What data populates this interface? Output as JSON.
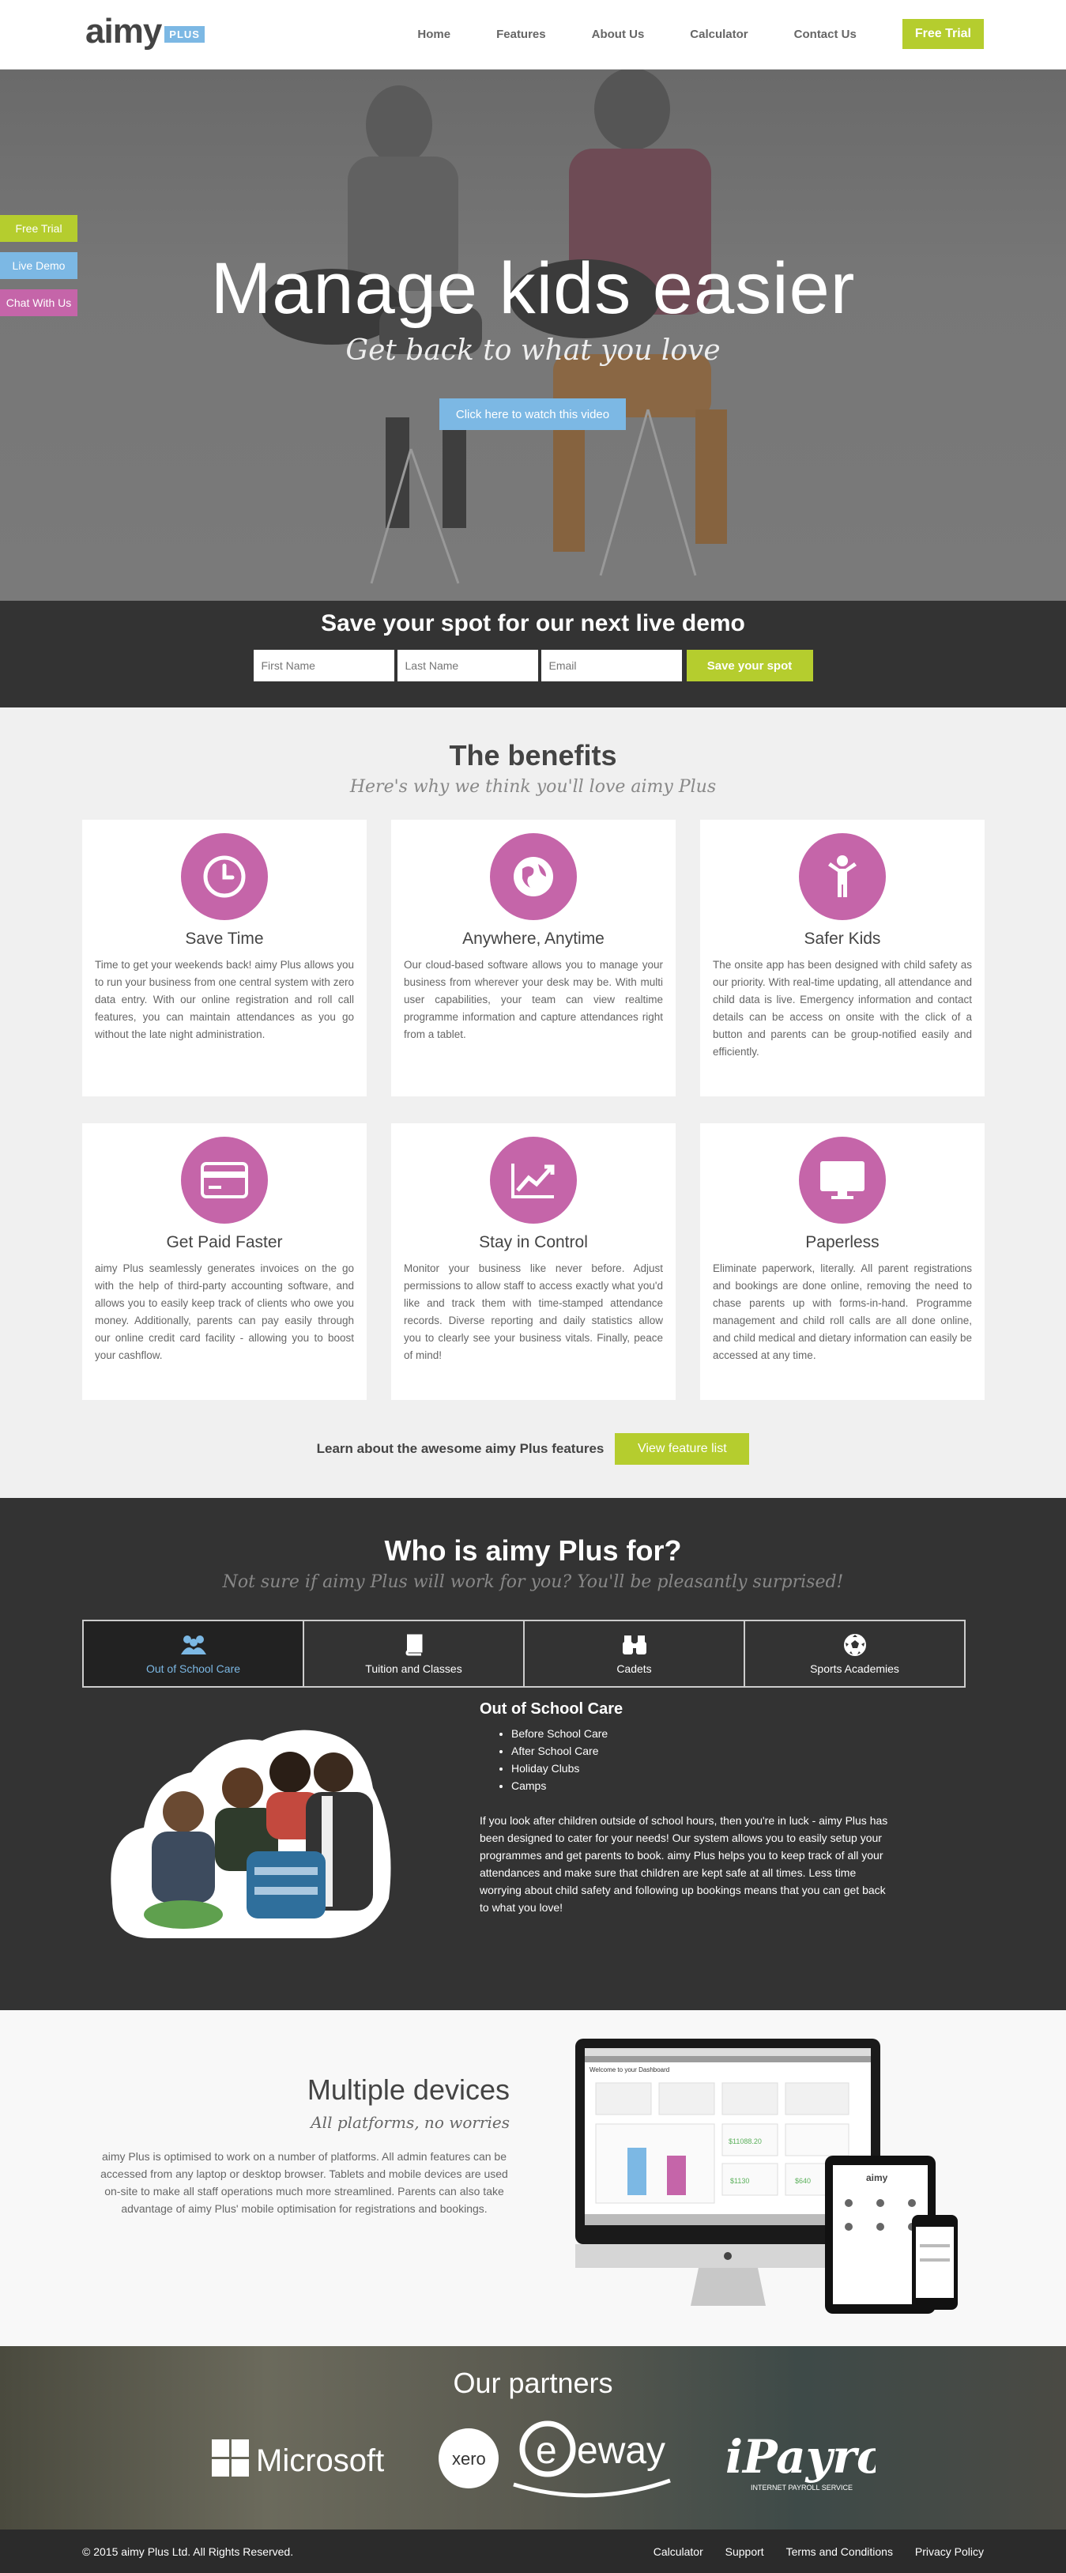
{
  "brand": {
    "logo_text": "aimy",
    "logo_badge": "PLUS"
  },
  "nav": {
    "items": [
      "Home",
      "Features",
      "About Us",
      "Calculator",
      "Contact Us"
    ],
    "trial": "Free Trial"
  },
  "side_tabs": {
    "free_trial": "Free Trial",
    "live_demo": "Live Demo",
    "chat": "Chat With Us"
  },
  "hero": {
    "title": "Manage kids easier",
    "subtitle": "Get back to what you love",
    "button": "Click here to watch this video"
  },
  "demo": {
    "title": "Save your spot for our next live demo",
    "first_name_placeholder": "First Name",
    "last_name_placeholder": "Last Name",
    "email_placeholder": "Email",
    "submit": "Save your spot"
  },
  "benefits": {
    "title": "The benefits",
    "subtitle": "Here's why we think you'll love aimy Plus",
    "cards": [
      {
        "icon": "clock-icon",
        "title": "Save Time",
        "text": "Time to get your weekends back! aimy Plus allows you to run your business from one central system with zero data entry. With our online registration and roll call features, you can maintain attendances as you go without the late night administration."
      },
      {
        "icon": "globe-icon",
        "title": "Anywhere, Anytime",
        "text": "Our cloud-based software allows you to manage your business from wherever your desk may be. With multi user capabilities, your team can view realtime programme information and capture attendances right from a tablet."
      },
      {
        "icon": "child-icon",
        "title": "Safer Kids",
        "text": "The onsite app has been designed with child safety as our priority. With real-time updating, all attendance and child data is live. Emergency information and contact details can be access on onsite with the click of a button and parents can be group-notified easily and efficiently."
      },
      {
        "icon": "credit-card-icon",
        "title": "Get Paid Faster",
        "text": "aimy Plus seamlessly generates invoices on the go with the help of third-party accounting software, and allows you to easily keep track of clients who owe you money. Additionally, parents can pay easily through our online credit card facility - allowing you to boost your cashflow."
      },
      {
        "icon": "chart-icon",
        "title": "Stay in Control",
        "text": "Monitor your business like never before. Adjust permissions to allow staff to access exactly what you'd like and track them with time-stamped attendance records. Diverse reporting and daily statistics allow you to clearly see your business vitals. Finally, peace of mind!"
      },
      {
        "icon": "monitor-icon",
        "title": "Paperless",
        "text": "Eliminate paperwork, literally. All parent registrations and bookings are done online, removing the need to chase parents up with forms-in-hand. Programme management and child roll calls are all done online, and child medical and dietary information can easily be accessed at any time."
      }
    ],
    "cta_text": "Learn about the awesome aimy Plus features",
    "cta_button": "View feature list"
  },
  "who": {
    "title": "Who is aimy Plus for?",
    "subtitle": "Not sure if aimy Plus will work for you? You'll be pleasantly surprised!",
    "tabs": [
      {
        "label": "Out of School Care",
        "icon": "people-icon"
      },
      {
        "label": "Tuition and Classes",
        "icon": "book-icon"
      },
      {
        "label": "Cadets",
        "icon": "binoculars-icon"
      },
      {
        "label": "Sports Academies",
        "icon": "soccer-ball-icon"
      }
    ],
    "content_title": "Out of School Care",
    "list": [
      "Before School Care",
      "After School Care",
      "Holiday Clubs",
      "Camps"
    ],
    "paragraph": "If you look after children outside of school hours, then you're in luck - aimy Plus has been designed to cater for your needs! Our system allows you to easily setup your programmes and get parents to book. aimy Plus helps you to keep track of all your attendances and make sure that children are kept safe at all times. Less time worrying about child safety and following up bookings means that you can get back to what you love!"
  },
  "devices": {
    "title": "Multiple devices",
    "subtitle": "All platforms, no worries",
    "text": "aimy Plus is optimised to work on a number of platforms. All admin features can be accessed from any laptop or desktop browser. Tablets and mobile devices are used on-site to make all staff operations much more streamlined. Parents can also take advantage of aimy Plus' mobile optimisation for registrations and bookings.",
    "screen_welcome": "Welcome to your Dashboard",
    "screen_amounts": [
      "$11088.20",
      "$1130",
      "$640"
    ],
    "tablet_brand": "aimy"
  },
  "partners": {
    "title": "Our partners",
    "logos": [
      "Microsoft",
      "xero",
      "eway",
      "iPayroll"
    ],
    "payroll_tag": "INTERNET PAYROLL SERVICE"
  },
  "footer": {
    "copyright": "© 2015 aimy Plus Ltd. All Rights Reserved.",
    "links": [
      "Calculator",
      "Support",
      "Terms and Conditions",
      "Privacy Policy"
    ]
  },
  "colors": {
    "accent_green": "#b5cd2e",
    "accent_blue": "#7cb8e4",
    "accent_pink": "#c565a9",
    "dark": "#333333"
  }
}
